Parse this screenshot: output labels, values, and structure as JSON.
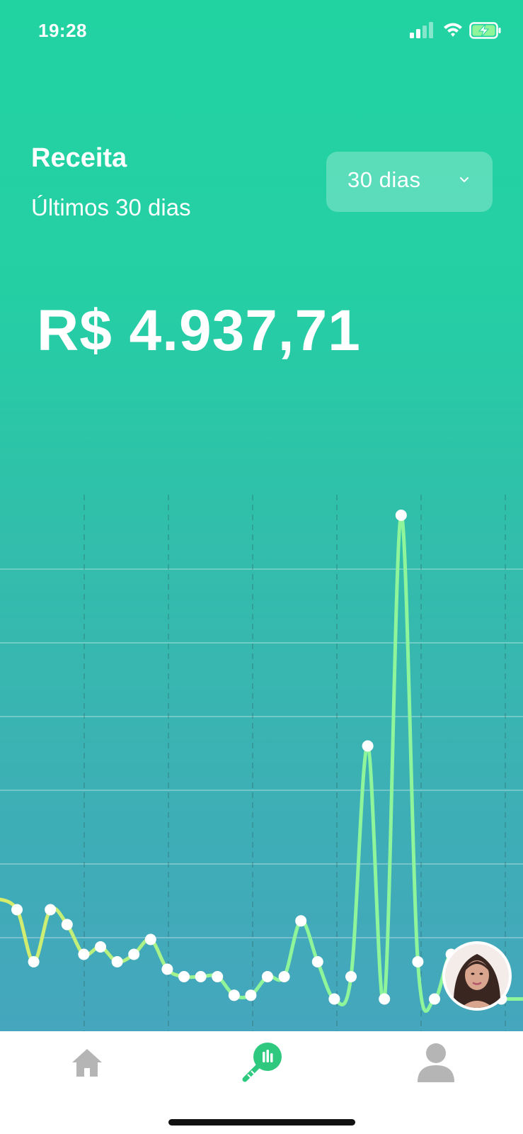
{
  "status_bar": {
    "time": "19:28"
  },
  "header": {
    "title": "Receita",
    "subtitle": "Últimos 30 dias"
  },
  "period_select": {
    "selected": "30 dias",
    "icon": "chevron-down-icon"
  },
  "summary": {
    "total": "R$ 4.937,71"
  },
  "colors": {
    "gradient_top": "#22d3a2",
    "gradient_bottom": "#45a6bd",
    "line_yellow": "#d9ec6a",
    "line_green": "#8ff59a",
    "point": "#ffffff",
    "nav_inactive": "#b5b5b5",
    "nav_active": "#2ec97f"
  },
  "chart_data": {
    "type": "line",
    "x": [
      1,
      2,
      3,
      4,
      5,
      6,
      7,
      8,
      9,
      10,
      11,
      12,
      13,
      14,
      15,
      16,
      17,
      18,
      19,
      20,
      21,
      22,
      23,
      24,
      25,
      26,
      27,
      28,
      29,
      30
    ],
    "series": [
      {
        "values": [
          70,
          0,
          70,
          50,
          10,
          20,
          0,
          10,
          30,
          -10,
          -20,
          -20,
          -20,
          -45,
          -45,
          -20,
          -20,
          55,
          0,
          -50,
          -20,
          290,
          -50,
          600,
          0,
          -50,
          10,
          -50,
          -50,
          -50
        ]
      }
    ],
    "grid": true
  },
  "bottom_nav": {
    "items": [
      {
        "id": "home",
        "icon": "home-icon",
        "active": false
      },
      {
        "id": "stats",
        "icon": "bar-chart-icon",
        "active": true
      },
      {
        "id": "profile",
        "icon": "person-icon",
        "active": false
      }
    ]
  }
}
